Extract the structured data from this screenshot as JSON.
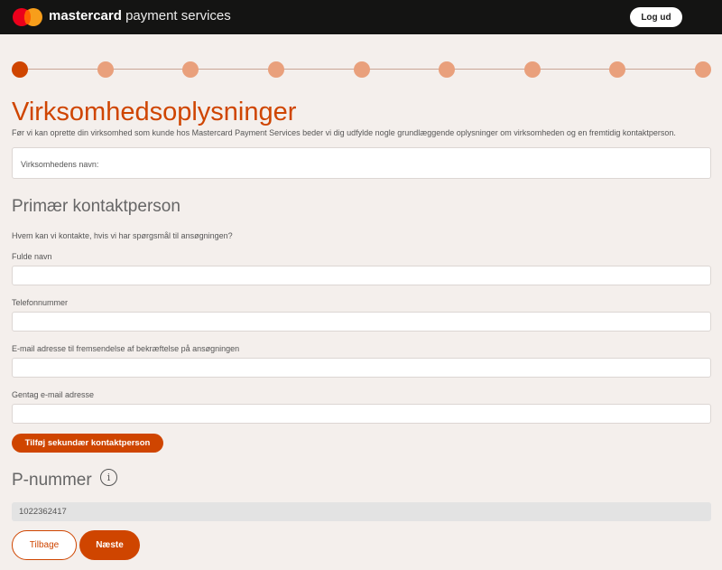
{
  "header": {
    "brand_bold": "mastercard",
    "brand_light": "payment services",
    "logout_label": "Log ud"
  },
  "progress": {
    "total_steps": 9,
    "current_step": 1
  },
  "page": {
    "title": "Virksomhedsoplysninger",
    "intro": "Før vi kan oprette din virksomhed som kunde hos Mastercard Payment Services beder vi dig udfylde nogle grundlæggende oplysninger om virksomheden og en fremtidig kontaktperson."
  },
  "company": {
    "name_label": "Virksomhedens navn:",
    "name_value": ""
  },
  "primary_contact": {
    "heading": "Primær kontaktperson",
    "question": "Hvem kan vi kontakte, hvis vi har spørgsmål til ansøgningen?",
    "fields": [
      {
        "label": "Fulde navn",
        "value": ""
      },
      {
        "label": "Telefonnummer",
        "value": ""
      },
      {
        "label": "E-mail adresse til fremsendelse af bekræftelse på ansøgningen",
        "value": ""
      },
      {
        "label": "Gentag e-mail adresse",
        "value": ""
      }
    ],
    "add_secondary_label": "Tilføj sekundær kontaktperson"
  },
  "p_number": {
    "heading": "P-nummer",
    "info_icon": "info-icon",
    "value": "1022362417"
  },
  "actions": {
    "back_label": "Tilbage",
    "next_label": "Næste"
  },
  "colors": {
    "accent": "#cf4500",
    "step_inactive": "#e9a07c",
    "topbar": "#141413",
    "background": "#f4efec"
  }
}
